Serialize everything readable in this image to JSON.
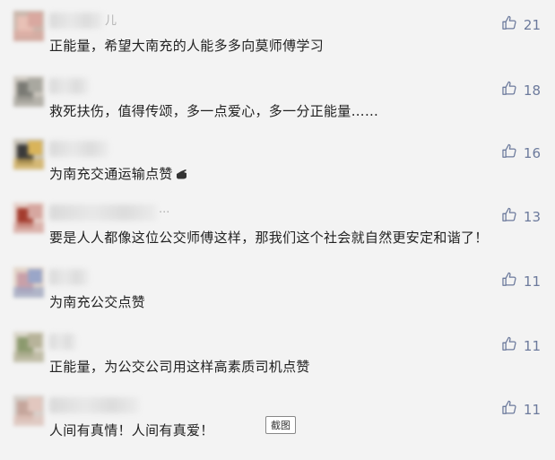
{
  "comments": [
    {
      "name_tail": "儿",
      "text": "正能量，希望大南充的人能多多向莫师傅学习",
      "likes": "21",
      "avatar_colors": [
        "#e8c1b6",
        "#d9a8a0",
        "#c9b7ac"
      ]
    },
    {
      "name_tail": "",
      "text": "救死扶伤，值得传颂，多一点爱心，多一分正能量……",
      "likes": "18",
      "avatar_colors": [
        "#7a7a74",
        "#a9a8a0",
        "#cfcac2"
      ]
    },
    {
      "name_tail": "",
      "text": "为南充交通运输点赞",
      "likes": "16",
      "has_hand": true,
      "avatar_colors": [
        "#3a3a3a",
        "#d9b45a",
        "#c9c4b8"
      ]
    },
    {
      "name_tail": "...",
      "text": "要是人人都像这位公交师傅这样，那我们这个社会就自然更安定和谐了！",
      "likes": "13",
      "avatar_colors": [
        "#a43c2e",
        "#d6a7a0",
        "#e6cfc8"
      ]
    },
    {
      "name_tail": "",
      "text": "为南充公交点赞",
      "likes": "11",
      "avatar_colors": [
        "#c9a0a8",
        "#9aa6c8",
        "#e3d5c9"
      ]
    },
    {
      "name_tail": "",
      "text": "正能量，为公交公司用这样高素质司机点赞",
      "likes": "11",
      "avatar_colors": [
        "#8c9a6e",
        "#b7b39a",
        "#dad6c9"
      ]
    },
    {
      "name_tail": "",
      "text": "人间有真情！人间有真爱！",
      "likes": "11",
      "avatar_colors": [
        "#c5a69c",
        "#e2c7bf",
        "#d6d0cb"
      ]
    }
  ],
  "tooltip": "截图",
  "colors": {
    "like": "#6c7a9c",
    "text": "#222222",
    "background": "#f3f3f3"
  }
}
